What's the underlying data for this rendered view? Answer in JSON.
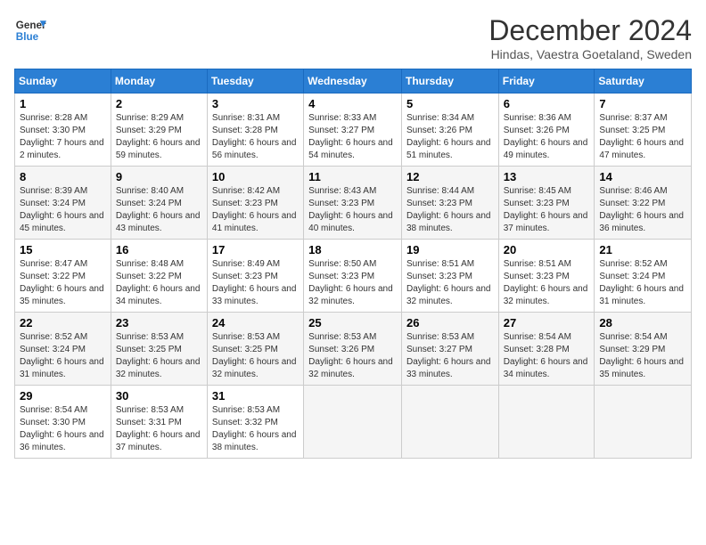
{
  "header": {
    "logo_line1": "General",
    "logo_line2": "Blue",
    "month_title": "December 2024",
    "subtitle": "Hindas, Vaestra Goetaland, Sweden"
  },
  "days_of_week": [
    "Sunday",
    "Monday",
    "Tuesday",
    "Wednesday",
    "Thursday",
    "Friday",
    "Saturday"
  ],
  "weeks": [
    [
      {
        "day": "1",
        "sunrise": "Sunrise: 8:28 AM",
        "sunset": "Sunset: 3:30 PM",
        "daylight": "Daylight: 7 hours and 2 minutes."
      },
      {
        "day": "2",
        "sunrise": "Sunrise: 8:29 AM",
        "sunset": "Sunset: 3:29 PM",
        "daylight": "Daylight: 6 hours and 59 minutes."
      },
      {
        "day": "3",
        "sunrise": "Sunrise: 8:31 AM",
        "sunset": "Sunset: 3:28 PM",
        "daylight": "Daylight: 6 hours and 56 minutes."
      },
      {
        "day": "4",
        "sunrise": "Sunrise: 8:33 AM",
        "sunset": "Sunset: 3:27 PM",
        "daylight": "Daylight: 6 hours and 54 minutes."
      },
      {
        "day": "5",
        "sunrise": "Sunrise: 8:34 AM",
        "sunset": "Sunset: 3:26 PM",
        "daylight": "Daylight: 6 hours and 51 minutes."
      },
      {
        "day": "6",
        "sunrise": "Sunrise: 8:36 AM",
        "sunset": "Sunset: 3:26 PM",
        "daylight": "Daylight: 6 hours and 49 minutes."
      },
      {
        "day": "7",
        "sunrise": "Sunrise: 8:37 AM",
        "sunset": "Sunset: 3:25 PM",
        "daylight": "Daylight: 6 hours and 47 minutes."
      }
    ],
    [
      {
        "day": "8",
        "sunrise": "Sunrise: 8:39 AM",
        "sunset": "Sunset: 3:24 PM",
        "daylight": "Daylight: 6 hours and 45 minutes."
      },
      {
        "day": "9",
        "sunrise": "Sunrise: 8:40 AM",
        "sunset": "Sunset: 3:24 PM",
        "daylight": "Daylight: 6 hours and 43 minutes."
      },
      {
        "day": "10",
        "sunrise": "Sunrise: 8:42 AM",
        "sunset": "Sunset: 3:23 PM",
        "daylight": "Daylight: 6 hours and 41 minutes."
      },
      {
        "day": "11",
        "sunrise": "Sunrise: 8:43 AM",
        "sunset": "Sunset: 3:23 PM",
        "daylight": "Daylight: 6 hours and 40 minutes."
      },
      {
        "day": "12",
        "sunrise": "Sunrise: 8:44 AM",
        "sunset": "Sunset: 3:23 PM",
        "daylight": "Daylight: 6 hours and 38 minutes."
      },
      {
        "day": "13",
        "sunrise": "Sunrise: 8:45 AM",
        "sunset": "Sunset: 3:23 PM",
        "daylight": "Daylight: 6 hours and 37 minutes."
      },
      {
        "day": "14",
        "sunrise": "Sunrise: 8:46 AM",
        "sunset": "Sunset: 3:22 PM",
        "daylight": "Daylight: 6 hours and 36 minutes."
      }
    ],
    [
      {
        "day": "15",
        "sunrise": "Sunrise: 8:47 AM",
        "sunset": "Sunset: 3:22 PM",
        "daylight": "Daylight: 6 hours and 35 minutes."
      },
      {
        "day": "16",
        "sunrise": "Sunrise: 8:48 AM",
        "sunset": "Sunset: 3:22 PM",
        "daylight": "Daylight: 6 hours and 34 minutes."
      },
      {
        "day": "17",
        "sunrise": "Sunrise: 8:49 AM",
        "sunset": "Sunset: 3:23 PM",
        "daylight": "Daylight: 6 hours and 33 minutes."
      },
      {
        "day": "18",
        "sunrise": "Sunrise: 8:50 AM",
        "sunset": "Sunset: 3:23 PM",
        "daylight": "Daylight: 6 hours and 32 minutes."
      },
      {
        "day": "19",
        "sunrise": "Sunrise: 8:51 AM",
        "sunset": "Sunset: 3:23 PM",
        "daylight": "Daylight: 6 hours and 32 minutes."
      },
      {
        "day": "20",
        "sunrise": "Sunrise: 8:51 AM",
        "sunset": "Sunset: 3:23 PM",
        "daylight": "Daylight: 6 hours and 32 minutes."
      },
      {
        "day": "21",
        "sunrise": "Sunrise: 8:52 AM",
        "sunset": "Sunset: 3:24 PM",
        "daylight": "Daylight: 6 hours and 31 minutes."
      }
    ],
    [
      {
        "day": "22",
        "sunrise": "Sunrise: 8:52 AM",
        "sunset": "Sunset: 3:24 PM",
        "daylight": "Daylight: 6 hours and 31 minutes."
      },
      {
        "day": "23",
        "sunrise": "Sunrise: 8:53 AM",
        "sunset": "Sunset: 3:25 PM",
        "daylight": "Daylight: 6 hours and 32 minutes."
      },
      {
        "day": "24",
        "sunrise": "Sunrise: 8:53 AM",
        "sunset": "Sunset: 3:25 PM",
        "daylight": "Daylight: 6 hours and 32 minutes."
      },
      {
        "day": "25",
        "sunrise": "Sunrise: 8:53 AM",
        "sunset": "Sunset: 3:26 PM",
        "daylight": "Daylight: 6 hours and 32 minutes."
      },
      {
        "day": "26",
        "sunrise": "Sunrise: 8:53 AM",
        "sunset": "Sunset: 3:27 PM",
        "daylight": "Daylight: 6 hours and 33 minutes."
      },
      {
        "day": "27",
        "sunrise": "Sunrise: 8:54 AM",
        "sunset": "Sunset: 3:28 PM",
        "daylight": "Daylight: 6 hours and 34 minutes."
      },
      {
        "day": "28",
        "sunrise": "Sunrise: 8:54 AM",
        "sunset": "Sunset: 3:29 PM",
        "daylight": "Daylight: 6 hours and 35 minutes."
      }
    ],
    [
      {
        "day": "29",
        "sunrise": "Sunrise: 8:54 AM",
        "sunset": "Sunset: 3:30 PM",
        "daylight": "Daylight: 6 hours and 36 minutes."
      },
      {
        "day": "30",
        "sunrise": "Sunrise: 8:53 AM",
        "sunset": "Sunset: 3:31 PM",
        "daylight": "Daylight: 6 hours and 37 minutes."
      },
      {
        "day": "31",
        "sunrise": "Sunrise: 8:53 AM",
        "sunset": "Sunset: 3:32 PM",
        "daylight": "Daylight: 6 hours and 38 minutes."
      },
      null,
      null,
      null,
      null
    ]
  ]
}
